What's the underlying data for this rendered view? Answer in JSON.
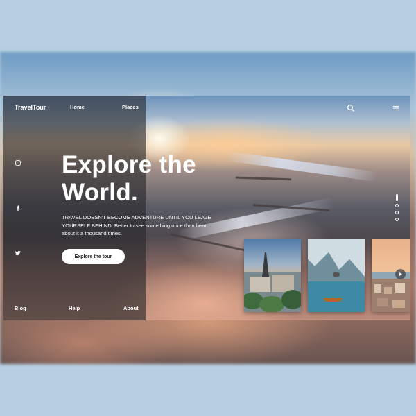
{
  "brand": "TravelTour",
  "nav": {
    "home": "Home",
    "places": "Places"
  },
  "icons": {
    "search": "search-icon",
    "menu": "menu-icon",
    "instagram": "instagram-icon",
    "facebook": "facebook-icon",
    "twitter": "twitter-icon",
    "play": "play-icon"
  },
  "hero": {
    "title_line1": "Explore the",
    "title_line2": "World.",
    "desc_line1": "TRAVEL DOESN'T BECOME ADVENTURE UNTIL YOU LEAVE",
    "desc_line2": "YOURSELF BEHIND. Better to see something once than hear",
    "desc_line3": "about it a thousand times.",
    "cta": "Explore the tour"
  },
  "footer": {
    "blog": "Blog",
    "help": "Help",
    "about": "About"
  },
  "slider": {
    "slide_count": 4,
    "active_index": 0
  },
  "thumbnails": [
    "paris-tower",
    "mountain-lake",
    "coastal-town"
  ],
  "colors": {
    "panel": "#26262a",
    "button_bg": "#ffffff",
    "button_text": "#222222",
    "page_bg": "#b7cfe0"
  }
}
